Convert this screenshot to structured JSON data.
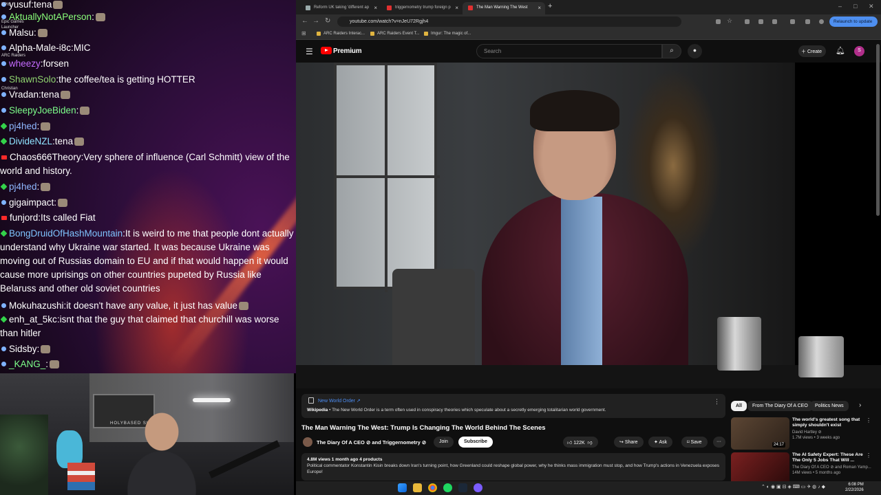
{
  "chat": {
    "messages": [
      {
        "badge": "blue",
        "user": "yusuf",
        "color": "#ffffff",
        "text": "tena",
        "emote": true
      },
      {
        "badge": "blue",
        "user": "AktuallyNotAPerson",
        "color": "#8aff7a",
        "text": "",
        "emote": true
      },
      {
        "badge": "blue",
        "user": "Malsu",
        "color": "#ffffff",
        "text": "",
        "emote": true
      },
      {
        "badge": "blue",
        "user": "Alpha-Male-i8c",
        "color": "#ffffff",
        "text": "MIC",
        "emote": false
      },
      {
        "badge": "blue",
        "user": "wheezy",
        "color": "#c56bff",
        "text": "forsen",
        "emote": false
      },
      {
        "badge": "blue",
        "user": "ShawnSolo",
        "color": "#8fd36f",
        "text": "the coffee/tea is getting HOTTER",
        "emote": false
      },
      {
        "badge": "blue",
        "user": "Vradan",
        "color": "#ffffff",
        "text": "tena",
        "emote": true
      },
      {
        "badge": "blue",
        "user": "SleepyJoeBiden",
        "color": "#7dff8a",
        "text": "",
        "emote": true
      },
      {
        "badge": "green",
        "user": "pj4hed",
        "color": "#8fb8ff",
        "text": "",
        "emote": true
      },
      {
        "badge": "green",
        "user": "DivideNZL",
        "color": "#8fe3ff",
        "text": "tena",
        "emote": true
      },
      {
        "badge": "red",
        "user": "Chaos666Theory",
        "color": "#ffffff",
        "text": "Very sphere of influence (Carl Schmitt) view of the world and history.",
        "emote": false
      },
      {
        "badge": "green",
        "user": "pj4hed",
        "color": "#8fb8ff",
        "text": "",
        "emote": true
      },
      {
        "badge": "blue",
        "user": "gigaimpact",
        "color": "#ffffff",
        "text": "",
        "emote": true
      },
      {
        "badge": "red",
        "user": "funjord",
        "color": "#ffffff",
        "text": "Its called Fiat",
        "emote": false
      },
      {
        "badge": "green",
        "user": "BongDruidOfHashMountain",
        "color": "#7fc4ff",
        "text": "It is weird to me that people dont actually understand why Ukraine war started. It was because Ukraine was moving out of Russias domain to EU and if that would happen it would cause more uprisings on other countries pupeted by Russia like Belaruss and other old soviet countries",
        "emote": false
      },
      {
        "badge": "blue",
        "user": "Mokuhazushi",
        "color": "#ffffff",
        "text": "it doesn't have any value, it just has value",
        "emote": true
      },
      {
        "badge": "green",
        "user": "enh_at_5kc",
        "color": "#ffffff",
        "text": "isnt that the guy that claimed that churchill was worse than hitler",
        "emote": false
      },
      {
        "badge": "blue",
        "user": "Sidsby",
        "color": "#ffffff",
        "text": "",
        "emote": true
      },
      {
        "badge": "blue",
        "user": "_KANG_",
        "color": "#7dff8a",
        "text": "",
        "emote": true
      }
    ],
    "desktop_icons": [
      "EPIC",
      "Epic Games",
      "Launcher",
      "ARC Raiders",
      "Christian"
    ]
  },
  "webcam": {
    "sign_text": "HOLYBASED SUBSCRIBE"
  },
  "browser": {
    "tabs": [
      {
        "title": "Reform UK taking 'different ap",
        "active": false,
        "color": "#7a9a7a"
      },
      {
        "title": "triggernometry trump foreign p",
        "active": false,
        "color": "#e03030"
      },
      {
        "title": "The Man Warning The West",
        "active": true,
        "color": "#e03030"
      }
    ],
    "new_tab": "+",
    "url": "youtube.com/watch?v=nJeU72Rgjh4",
    "relaunch": "Relaunch to update",
    "bookmarks": [
      "ARC Raiders Interac...",
      "ARC Raiders Event T...",
      "Imgur: The magic of..."
    ]
  },
  "youtube": {
    "logo_text": "Premium",
    "search_placeholder": "Search",
    "create_label": "Create",
    "avatar_letter": "S",
    "wiki": {
      "title": "New World Order ↗",
      "source": "Wikipedia",
      "text": "• The New World Order is a term often used in conspiracy theories which speculate about a secretly emerging totalitarian world government."
    },
    "video_title": "The Man Warning The West: Trump Is Changing The World Behind The Scenes",
    "channel": "The Diary Of A CEO ⊘ and Triggernometry ⊘",
    "join": "Join",
    "subscribe": "Subscribe",
    "likes": "122K",
    "share": "Share",
    "ask": "Ask",
    "save": "Save",
    "more": "···",
    "desc_meta": "4.8M views  1 month ago  4 products",
    "desc_text": "Political commentator Konstantin Kisin breaks down Iran's turning point, how Greenland could reshape global power, why he thinks mass immigration must stop, and how Trump's actions in Venezuela exposes Europe!",
    "chips": [
      "All",
      "From The Diary Of A CEO",
      "Politics News"
    ],
    "recs": [
      {
        "title": "The world's greatest song that simply shouldn't exist",
        "channel": "David Hartley ⊘",
        "views": "1.7M views • 3 weeks ago",
        "duration": "24:17"
      },
      {
        "title": "The AI Safety Expert: These Are The Only 5 Jobs That Will ...",
        "channel": "The Diary Of A CEO ⊘ and Roman Yamp...",
        "views": "14M views • 5 months ago",
        "duration": ""
      }
    ]
  },
  "taskbar": {
    "time": "6:08 PM",
    "date": "2/22/2026"
  },
  "colors": {
    "yt_red": "#ff0000",
    "accent_blue": "#4d8ef5",
    "relaunch_blue": "#4e8ff0"
  }
}
